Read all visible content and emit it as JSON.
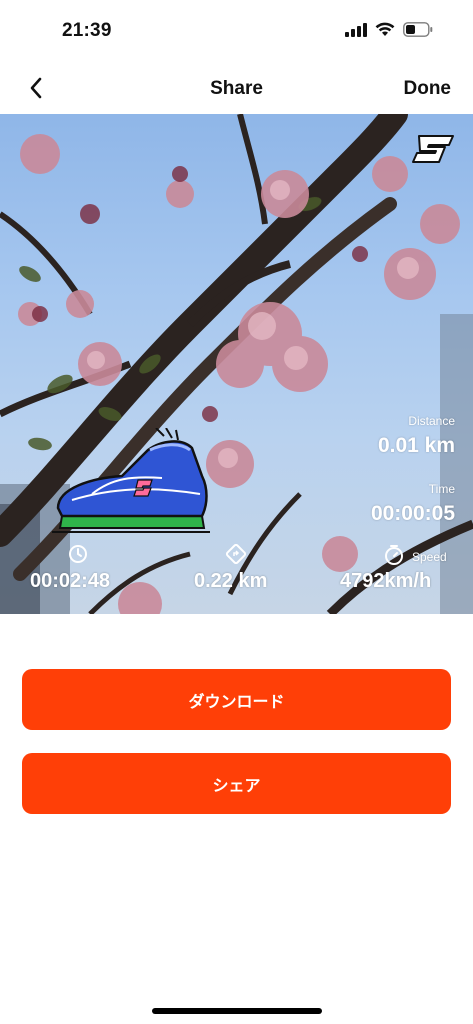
{
  "status": {
    "time": "21:39"
  },
  "nav": {
    "title": "Share",
    "done_label": "Done"
  },
  "stats": {
    "distance_label": "Distance",
    "distance_value": "0.01 km",
    "time_label": "Time",
    "time_value": "00:00:05",
    "speed_label": "Speed",
    "duration_value": "00:02:48",
    "altitude_value": "0.22 km",
    "speed_value": "4792km/h"
  },
  "actions": {
    "download_label": "ダウンロード",
    "share_label": "シェア"
  },
  "colors": {
    "accent": "#ff3f07"
  },
  "icons": [
    "chevron-left-icon",
    "signal-icon",
    "wifi-icon",
    "battery-icon",
    "brand-logo-icon",
    "shoe-sticker",
    "clock-icon",
    "direction-icon",
    "stopwatch-icon"
  ]
}
